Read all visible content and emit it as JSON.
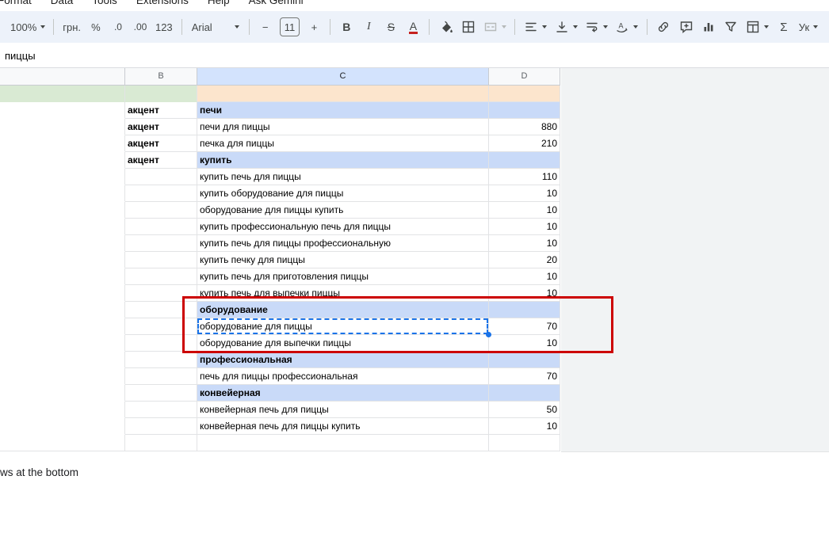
{
  "menu": {
    "items": [
      "Format",
      "Data",
      "Tools",
      "Extensions",
      "Help",
      "Ask Gemini"
    ]
  },
  "toolbar": {
    "zoom_label": "100%",
    "currency_label": "грн.",
    "percent_label": "%",
    "decrease_decimal_label": ".0",
    "increase_decimal_label": ".00",
    "number_format_label": "123",
    "font_family": "Arial",
    "decrease_font_label": "−",
    "font_size": "11",
    "increase_font_label": "+",
    "bold_label": "B",
    "italic_label": "I",
    "strikethrough_label": "S",
    "text_color_label": "A",
    "functions_label": "Σ",
    "custom_label": "Ук",
    "icons": [
      "fill-color-icon",
      "borders-icon",
      "merge-cells-icon",
      "horizontal-align-icon",
      "vertical-align-icon",
      "text-wrap-icon",
      "text-rotation-icon",
      "insert-link-icon",
      "insert-comment-icon",
      "insert-chart-icon",
      "create-filter-icon",
      "table-icon",
      "chevron-down-icon"
    ]
  },
  "formula_bar": {
    "text": "пиццы"
  },
  "sheet": {
    "column_headers": [
      "B",
      "C",
      "D"
    ],
    "selected_column": "C",
    "rows": [
      {
        "a": "",
        "b": "",
        "c": "",
        "d": "",
        "type": "colored"
      },
      {
        "a": "",
        "b": "акцент",
        "c": "печи",
        "d": "",
        "type": "section"
      },
      {
        "a": "",
        "b": "акцент",
        "c": "печи для пиццы",
        "d": "880",
        "type": "data"
      },
      {
        "a": "",
        "b": "акцент",
        "c": "печка для пиццы",
        "d": "210",
        "type": "data"
      },
      {
        "a": "",
        "b": "акцент",
        "c": "купить",
        "d": "",
        "type": "section"
      },
      {
        "a": "",
        "b": "",
        "c": "купить печь для пиццы",
        "d": "110",
        "type": "data"
      },
      {
        "a": "",
        "b": "",
        "c": "купить оборудование для пиццы",
        "d": "10",
        "type": "data"
      },
      {
        "a": "",
        "b": "",
        "c": "оборудование для пиццы купить",
        "d": "10",
        "type": "data"
      },
      {
        "a": "",
        "b": "",
        "c": "купить профессиональную печь для пиццы",
        "d": "10",
        "type": "data"
      },
      {
        "a": "",
        "b": "",
        "c": "купить печь для пиццы профессиональную",
        "d": "10",
        "type": "data"
      },
      {
        "a": "",
        "b": "",
        "c": "купить печку для пиццы",
        "d": "20",
        "type": "data"
      },
      {
        "a": "",
        "b": "",
        "c": "купить печь для приготовления пиццы",
        "d": "10",
        "type": "data"
      },
      {
        "a": "",
        "b": "",
        "c": "купить печь для выпечки пиццы",
        "d": "10",
        "type": "data"
      },
      {
        "a": "",
        "b": "",
        "c": "оборудование",
        "d": "",
        "type": "section"
      },
      {
        "a": "",
        "b": "",
        "c": "оборудование для пиццы",
        "d": "70",
        "type": "data",
        "selected": true
      },
      {
        "a": "",
        "b": "",
        "c": "оборудование для выпечки пиццы",
        "d": "10",
        "type": "data"
      },
      {
        "a": "",
        "b": "",
        "c": "профессиональная",
        "d": "",
        "type": "section"
      },
      {
        "a": "",
        "b": "",
        "c": "печь для пиццы профессиональная",
        "d": "70",
        "type": "data"
      },
      {
        "a": "",
        "b": "",
        "c": "конвейерная",
        "d": "",
        "type": "section"
      },
      {
        "a": "",
        "b": "",
        "c": "конвейерная печь для пиццы",
        "d": "50",
        "type": "data"
      },
      {
        "a": "",
        "b": "",
        "c": "конвейерная печь для пиццы купить",
        "d": "10",
        "type": "data"
      },
      {
        "a": "",
        "b": "",
        "c": "",
        "d": "",
        "type": "data"
      }
    ],
    "colors": {
      "section_header_bg": "#c9daf8",
      "green_row_bg": "#d9ead3",
      "orange_row_bg": "#fce5cd",
      "selected_column_header_bg": "#d3e3fd",
      "selection_blue": "#1a73e8",
      "annotation_red": "#cc0000"
    }
  },
  "footer": {
    "text": "ws at the bottom"
  }
}
